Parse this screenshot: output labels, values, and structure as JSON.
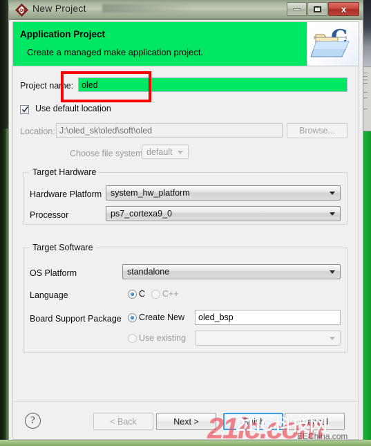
{
  "window": {
    "title": "New Project",
    "icon": "sdk-icon",
    "controls": {
      "minimize": "minimize-button",
      "maximize": "maximize-button",
      "close_label": "x"
    }
  },
  "header": {
    "title": "Application Project",
    "subtitle": "Create a managed make application project.",
    "banner_color": "#00e764",
    "image": "c-project-folder-icon"
  },
  "form": {
    "project_name_label": "Project name:",
    "project_name_value": "oled",
    "project_name_placeholder": "",
    "use_default_location_label": "Use default location",
    "use_default_location_checked": true,
    "location_label": "Location:",
    "location_value": "J:\\oled_sk\\oled\\soft\\oled",
    "browse_label": "Browse...",
    "choose_file_system_label": "Choose file system:",
    "file_system_value": "default"
  },
  "target_hardware": {
    "group_label": "Target Hardware",
    "hardware_platform_label": "Hardware Platform",
    "hardware_platform_value": "system_hw_platform",
    "processor_label": "Processor",
    "processor_value": "ps7_cortexa9_0"
  },
  "target_software": {
    "group_label": "Target Software",
    "os_platform_label": "OS Platform",
    "os_platform_value": "standalone",
    "language_label": "Language",
    "language_options": [
      {
        "label": "C",
        "selected": true,
        "enabled": true
      },
      {
        "label": "C++",
        "selected": false,
        "enabled": false
      }
    ],
    "bsp_label": "Board Support Package",
    "bsp_create_new_label": "Create New",
    "bsp_create_new_selected": true,
    "bsp_name_value": "oled_bsp",
    "bsp_use_existing_label": "Use existing",
    "bsp_use_existing_selected": false,
    "bsp_existing_value": ""
  },
  "footer": {
    "help_label": "?",
    "back_label": "< Back",
    "next_label": "Next >",
    "finish_label": "Finish",
    "cancel_label": "Cancel"
  },
  "watermarks": {
    "primary": "21ic.com",
    "secondary": "21IC科技网",
    "tertiary": "EEChina.com"
  },
  "colors": {
    "accent_green": "#00e764",
    "highlight_red": "#fb0000",
    "focus_blue": "#3c9edc"
  }
}
